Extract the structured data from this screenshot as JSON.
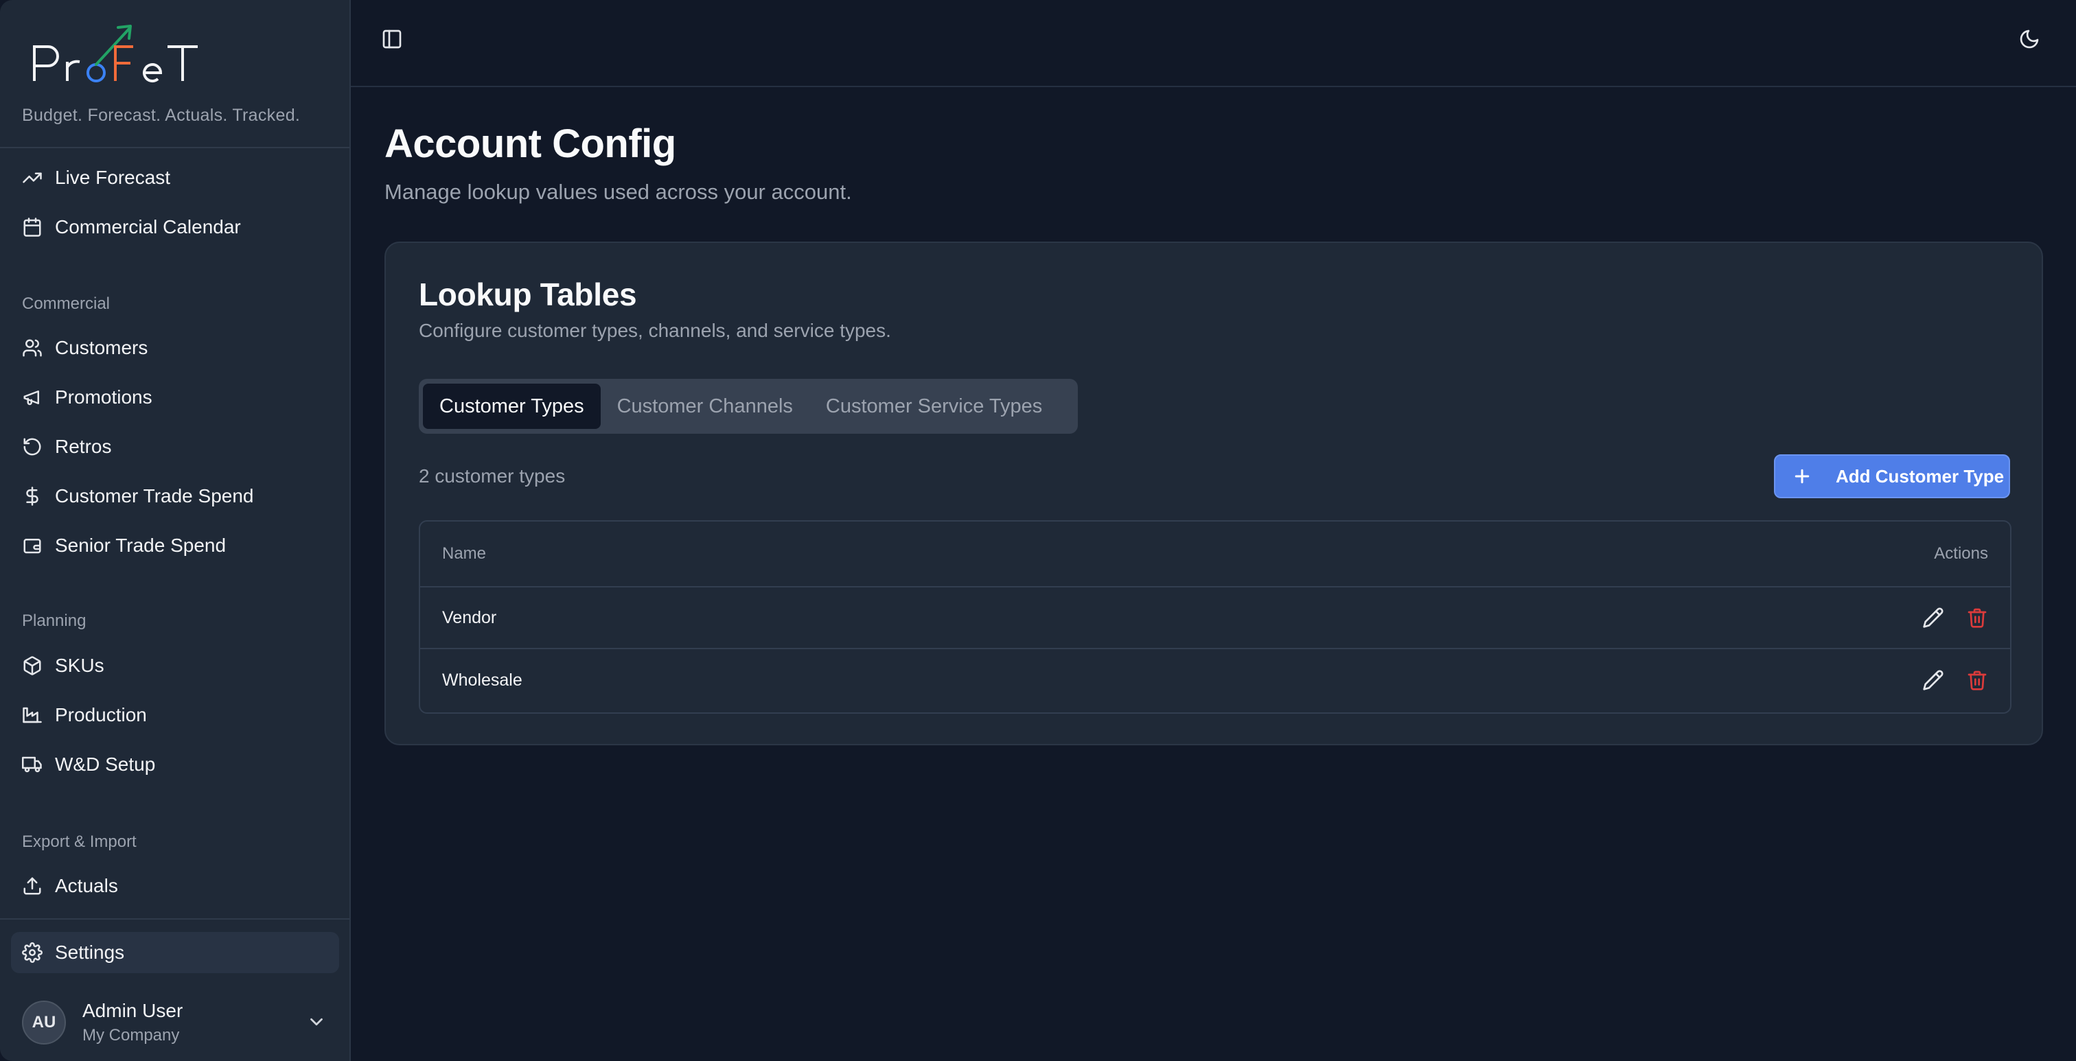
{
  "brand": {
    "logo_text": "ProFeT",
    "tagline": "Budget. Forecast. Actuals. Tracked."
  },
  "sidebar": {
    "top_items": [
      {
        "label": "Live Forecast",
        "icon": "trending-up-icon"
      },
      {
        "label": "Commercial Calendar",
        "icon": "calendar-icon"
      }
    ],
    "sections": [
      {
        "label": "Commercial",
        "items": [
          {
            "label": "Customers",
            "icon": "users-icon"
          },
          {
            "label": "Promotions",
            "icon": "megaphone-icon"
          },
          {
            "label": "Retros",
            "icon": "rotate-ccw-icon"
          },
          {
            "label": "Customer Trade Spend",
            "icon": "dollar-sign-icon"
          },
          {
            "label": "Senior Trade Spend",
            "icon": "wallet-icon"
          }
        ]
      },
      {
        "label": "Planning",
        "items": [
          {
            "label": "SKUs",
            "icon": "package-icon"
          },
          {
            "label": "Production",
            "icon": "factory-icon"
          },
          {
            "label": "W&D Setup",
            "icon": "truck-icon"
          }
        ]
      },
      {
        "label": "Export & Import",
        "items": [
          {
            "label": "Actuals",
            "icon": "upload-icon"
          }
        ]
      }
    ],
    "settings": {
      "label": "Settings",
      "icon": "gear-icon",
      "active": true
    },
    "user": {
      "initials": "AU",
      "name": "Admin User",
      "company": "My Company"
    }
  },
  "topbar": {
    "left_icon": "panel-left-icon",
    "right_icon": "moon-icon"
  },
  "page": {
    "title": "Account Config",
    "subtitle": "Manage lookup values used across your account."
  },
  "card": {
    "title": "Lookup Tables",
    "description": "Configure customer types, channels, and service types.",
    "tabs": [
      {
        "label": "Customer Types",
        "active": true
      },
      {
        "label": "Customer Channels",
        "active": false
      },
      {
        "label": "Customer Service Types",
        "active": false
      }
    ],
    "count_text": "2 customer types",
    "add_button_label": "Add Customer Type",
    "table": {
      "columns": [
        "Name",
        "Actions"
      ],
      "rows": [
        {
          "name": "Vendor"
        },
        {
          "name": "Wholesale"
        }
      ]
    }
  },
  "colors": {
    "background": "#111827",
    "sidebar": "#1f2937",
    "accent": "#4f7ee8",
    "danger": "#dc3b3b",
    "logo_orange": "#f26b3a",
    "logo_blue": "#3b82f6",
    "logo_green": "#22a365"
  }
}
